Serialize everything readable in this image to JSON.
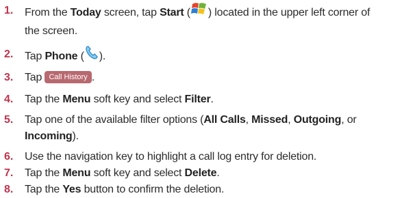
{
  "steps": [
    {
      "num": "1.",
      "t1": "From the ",
      "b1": "Today",
      "t2": " screen, tap ",
      "b2": "Start",
      "t3": " (",
      "t4": ") located in the upper left corner of",
      "t5": "the screen."
    },
    {
      "num": "2.",
      "t1": "Tap ",
      "b1": "Phone",
      "t2": " (",
      "t3": ")."
    },
    {
      "num": "3.",
      "t1": "Tap ",
      "button": "Call History",
      "t2": "."
    },
    {
      "num": "4.",
      "t1": "Tap the ",
      "b1": "Menu",
      "t2": " soft key and select ",
      "b2": "Filter",
      "t3": "."
    },
    {
      "num": "5.",
      "t1": "Tap one of the available filter options (",
      "b1": "All Calls",
      "t2": ", ",
      "b2": "Missed",
      "t3": ", ",
      "b3": "Outgoing",
      "t4": ", or",
      "b4": "Incoming",
      "t5": ")."
    },
    {
      "num": "6.",
      "t1": "Use the navigation key to highlight a call log entry for deletion."
    },
    {
      "num": "7.",
      "t1": "Tap the ",
      "b1": "Menu",
      "t2": " soft key and select ",
      "b2": "Delete",
      "t3": "."
    },
    {
      "num": "8.",
      "t1": "Tap the ",
      "b1": "Yes",
      "t2": " button to confirm the deletion."
    }
  ],
  "icons": {
    "start": "windows-start-icon",
    "phone": "phone-handset-icon"
  },
  "colors": {
    "step_number": "#c0334d",
    "call_history_button": "#b8696f"
  }
}
